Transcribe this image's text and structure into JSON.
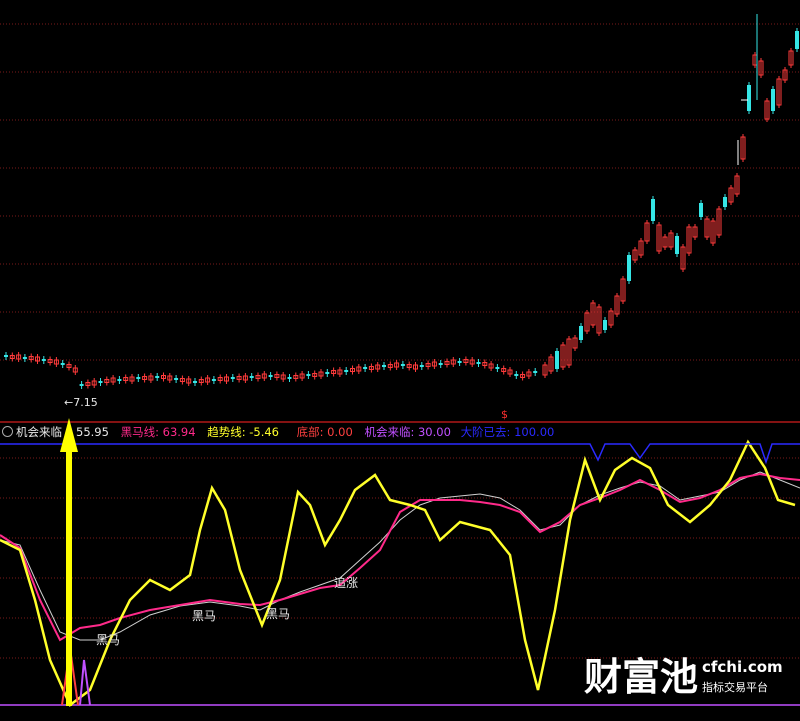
{
  "colors": {
    "background": "#000000",
    "grid": "#7a1a1a",
    "separator": "#b01818",
    "up": "#ff3b3b",
    "down": "#35e6e6",
    "heima": "#ff2a8a",
    "trend": "#ffff2a",
    "mid": "#d0d0d0",
    "bottom": "#ff4040",
    "chance": "#c050ff",
    "bigup": "#2a2aff",
    "arrow": "#ffff00",
    "label": "#e8e8e8"
  },
  "price_panel": {
    "low_marker": "←7.15",
    "top_marker": "$"
  },
  "indicator_legend": {
    "toggle_icon": "circle-toggle-icon",
    "name": "机会来临",
    "value_first": "55.95",
    "heima_label": "黑马线: 63.94",
    "trend_label": "趋势线: -5.46",
    "bottom_label": "底部: 0.00",
    "chance_label": "机会来临: 30.00",
    "bigup_label": "大阶已去: 100.00"
  },
  "annotations": [
    "黑马",
    "黑马",
    "黑马",
    "追涨"
  ],
  "watermark": {
    "brand": "财富池",
    "domain": "cfchi.com",
    "tagline": "指标交易平台"
  }
}
